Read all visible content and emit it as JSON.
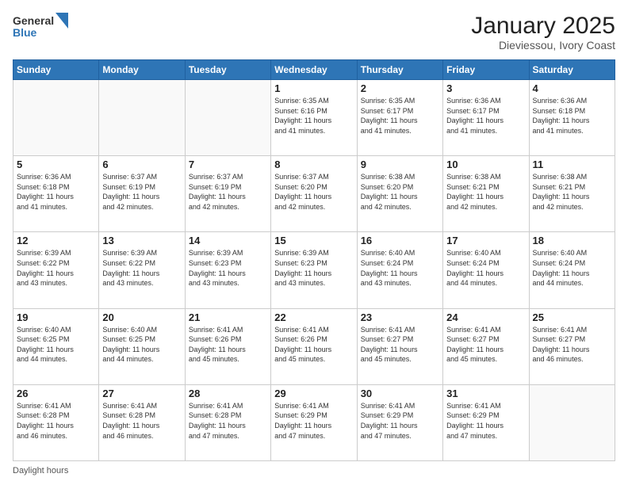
{
  "header": {
    "logo_line1": "General",
    "logo_line2": "Blue",
    "title": "January 2025",
    "subtitle": "Dieviessou, Ivory Coast"
  },
  "days_of_week": [
    "Sunday",
    "Monday",
    "Tuesday",
    "Wednesday",
    "Thursday",
    "Friday",
    "Saturday"
  ],
  "weeks": [
    [
      {
        "day": "",
        "info": ""
      },
      {
        "day": "",
        "info": ""
      },
      {
        "day": "",
        "info": ""
      },
      {
        "day": "1",
        "info": "Sunrise: 6:35 AM\nSunset: 6:16 PM\nDaylight: 11 hours\nand 41 minutes."
      },
      {
        "day": "2",
        "info": "Sunrise: 6:35 AM\nSunset: 6:17 PM\nDaylight: 11 hours\nand 41 minutes."
      },
      {
        "day": "3",
        "info": "Sunrise: 6:36 AM\nSunset: 6:17 PM\nDaylight: 11 hours\nand 41 minutes."
      },
      {
        "day": "4",
        "info": "Sunrise: 6:36 AM\nSunset: 6:18 PM\nDaylight: 11 hours\nand 41 minutes."
      }
    ],
    [
      {
        "day": "5",
        "info": "Sunrise: 6:36 AM\nSunset: 6:18 PM\nDaylight: 11 hours\nand 41 minutes."
      },
      {
        "day": "6",
        "info": "Sunrise: 6:37 AM\nSunset: 6:19 PM\nDaylight: 11 hours\nand 42 minutes."
      },
      {
        "day": "7",
        "info": "Sunrise: 6:37 AM\nSunset: 6:19 PM\nDaylight: 11 hours\nand 42 minutes."
      },
      {
        "day": "8",
        "info": "Sunrise: 6:37 AM\nSunset: 6:20 PM\nDaylight: 11 hours\nand 42 minutes."
      },
      {
        "day": "9",
        "info": "Sunrise: 6:38 AM\nSunset: 6:20 PM\nDaylight: 11 hours\nand 42 minutes."
      },
      {
        "day": "10",
        "info": "Sunrise: 6:38 AM\nSunset: 6:21 PM\nDaylight: 11 hours\nand 42 minutes."
      },
      {
        "day": "11",
        "info": "Sunrise: 6:38 AM\nSunset: 6:21 PM\nDaylight: 11 hours\nand 42 minutes."
      }
    ],
    [
      {
        "day": "12",
        "info": "Sunrise: 6:39 AM\nSunset: 6:22 PM\nDaylight: 11 hours\nand 43 minutes."
      },
      {
        "day": "13",
        "info": "Sunrise: 6:39 AM\nSunset: 6:22 PM\nDaylight: 11 hours\nand 43 minutes."
      },
      {
        "day": "14",
        "info": "Sunrise: 6:39 AM\nSunset: 6:23 PM\nDaylight: 11 hours\nand 43 minutes."
      },
      {
        "day": "15",
        "info": "Sunrise: 6:39 AM\nSunset: 6:23 PM\nDaylight: 11 hours\nand 43 minutes."
      },
      {
        "day": "16",
        "info": "Sunrise: 6:40 AM\nSunset: 6:24 PM\nDaylight: 11 hours\nand 43 minutes."
      },
      {
        "day": "17",
        "info": "Sunrise: 6:40 AM\nSunset: 6:24 PM\nDaylight: 11 hours\nand 44 minutes."
      },
      {
        "day": "18",
        "info": "Sunrise: 6:40 AM\nSunset: 6:24 PM\nDaylight: 11 hours\nand 44 minutes."
      }
    ],
    [
      {
        "day": "19",
        "info": "Sunrise: 6:40 AM\nSunset: 6:25 PM\nDaylight: 11 hours\nand 44 minutes."
      },
      {
        "day": "20",
        "info": "Sunrise: 6:40 AM\nSunset: 6:25 PM\nDaylight: 11 hours\nand 44 minutes."
      },
      {
        "day": "21",
        "info": "Sunrise: 6:41 AM\nSunset: 6:26 PM\nDaylight: 11 hours\nand 45 minutes."
      },
      {
        "day": "22",
        "info": "Sunrise: 6:41 AM\nSunset: 6:26 PM\nDaylight: 11 hours\nand 45 minutes."
      },
      {
        "day": "23",
        "info": "Sunrise: 6:41 AM\nSunset: 6:27 PM\nDaylight: 11 hours\nand 45 minutes."
      },
      {
        "day": "24",
        "info": "Sunrise: 6:41 AM\nSunset: 6:27 PM\nDaylight: 11 hours\nand 45 minutes."
      },
      {
        "day": "25",
        "info": "Sunrise: 6:41 AM\nSunset: 6:27 PM\nDaylight: 11 hours\nand 46 minutes."
      }
    ],
    [
      {
        "day": "26",
        "info": "Sunrise: 6:41 AM\nSunset: 6:28 PM\nDaylight: 11 hours\nand 46 minutes."
      },
      {
        "day": "27",
        "info": "Sunrise: 6:41 AM\nSunset: 6:28 PM\nDaylight: 11 hours\nand 46 minutes."
      },
      {
        "day": "28",
        "info": "Sunrise: 6:41 AM\nSunset: 6:28 PM\nDaylight: 11 hours\nand 47 minutes."
      },
      {
        "day": "29",
        "info": "Sunrise: 6:41 AM\nSunset: 6:29 PM\nDaylight: 11 hours\nand 47 minutes."
      },
      {
        "day": "30",
        "info": "Sunrise: 6:41 AM\nSunset: 6:29 PM\nDaylight: 11 hours\nand 47 minutes."
      },
      {
        "day": "31",
        "info": "Sunrise: 6:41 AM\nSunset: 6:29 PM\nDaylight: 11 hours\nand 47 minutes."
      },
      {
        "day": "",
        "info": ""
      }
    ]
  ],
  "footer": {
    "text": "Daylight hours"
  }
}
